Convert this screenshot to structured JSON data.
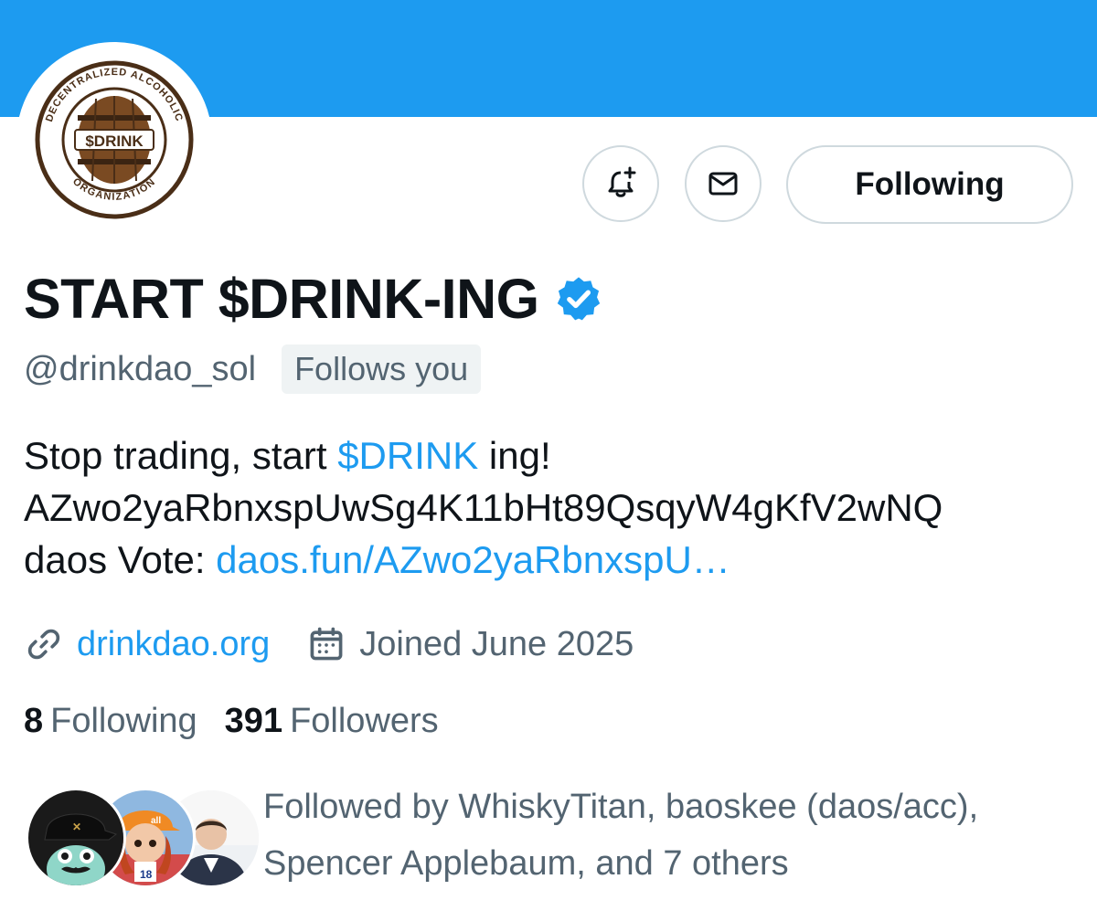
{
  "profile": {
    "display_name": "START $DRINK-ING",
    "handle": "@drinkdao_sol",
    "follows_you_badge": "Follows you",
    "verified_icon": "verified-badge-icon",
    "avatar_logo": {
      "top_arc_text": "DECENTRALIZED ALCOHOLIC",
      "bottom_arc_text": "ORGANIZATION",
      "center_text": "$DRINK"
    }
  },
  "actions": {
    "notify_icon": "bell-plus-icon",
    "message_icon": "envelope-icon",
    "following_label": "Following"
  },
  "bio": {
    "line1_pre": "Stop trading, start ",
    "line1_link": "$DRINK",
    "line1_post": " ing!",
    "line2": "AZwo2yaRbnxspUwSg4K11bHt89QsqyW4gKfV2wNQ",
    "line3_pre": "daos Vote: ",
    "line3_link": "daos.fun/AZwo2yaRbnxspU…"
  },
  "meta": {
    "website_icon": "link-icon",
    "website": "drinkdao.org",
    "joined_icon": "calendar-icon",
    "joined": "Joined June 2025"
  },
  "stats": {
    "following_count": "8",
    "following_label": "Following",
    "followers_count": "391",
    "followers_label": "Followers"
  },
  "followed_by": {
    "line1": "Followed by WhiskyTitan, baoskee (daos/acc),",
    "line2": "Spencer Applebaum, and 7 others"
  },
  "colors": {
    "banner": "#1d9bf0",
    "link": "#1d9bf0",
    "secondary_text": "#536471",
    "primary_text": "#0f1419"
  }
}
